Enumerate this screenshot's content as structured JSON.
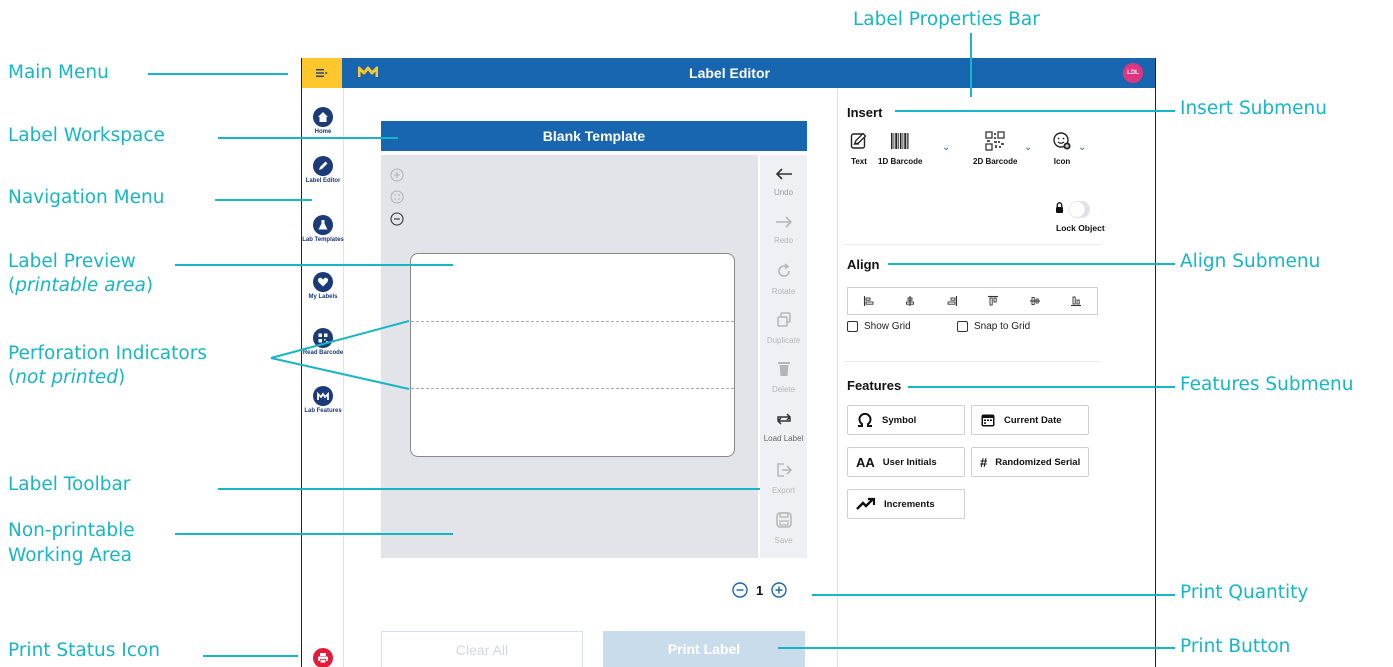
{
  "callouts": {
    "label_properties_bar": "Label Properties Bar",
    "main_menu": "Main Menu",
    "label_workspace": "Label Workspace",
    "navigation_menu": "Navigation Menu",
    "label_preview": "Label Preview",
    "label_preview_sub": "printable area",
    "perforation_indicators": "Perforation Indicators",
    "perforation_sub": "not printed",
    "label_toolbar": "Label Toolbar",
    "non_printable_1": "Non-printable",
    "non_printable_2": "Working Area",
    "print_status_icon": "Print Status Icon",
    "insert_submenu": "Insert Submenu",
    "align_submenu": "Align Submenu",
    "features_submenu": "Features Submenu",
    "print_quantity": "Print Quantity",
    "print_button": "Print Button"
  },
  "app": {
    "title": "Label Editor",
    "avatar_initials": "LDL",
    "brand_color": "#1866b0",
    "menu_color": "#ffc72c"
  },
  "nav": {
    "items": [
      {
        "label": "Home",
        "icon": "home-icon"
      },
      {
        "label": "Label Editor",
        "icon": "pencil-icon"
      },
      {
        "label": "Lab Templates",
        "icon": "flask-icon"
      },
      {
        "label": "My Labels",
        "icon": "heart-icon"
      },
      {
        "label": "Read Barcode",
        "icon": "qr-code-icon"
      },
      {
        "label": "Lab Features",
        "icon": "brand-logo-icon"
      }
    ]
  },
  "workspace": {
    "template_title": "Blank Template",
    "print_quantity": "1",
    "clear_all": "Clear All",
    "print_label": "Print Label"
  },
  "toolbar": {
    "undo": "Undo",
    "redo": "Redo",
    "rotate": "Rotate",
    "duplicate": "Duplicate",
    "delete": "Delete",
    "load_label": "Load Label",
    "export": "Export",
    "save": "Save"
  },
  "insert": {
    "title": "Insert",
    "text": "Text",
    "barcode_1d": "1D Barcode",
    "barcode_2d": "2D Barcode",
    "icon": "Icon",
    "lock_object": "Lock Object"
  },
  "align": {
    "title": "Align",
    "show_grid": "Show Grid",
    "snap_to_grid": "Snap to Grid"
  },
  "features": {
    "title": "Features",
    "symbol": "Symbol",
    "current_date": "Current Date",
    "user_initials": "User Initials",
    "randomized_serial": "Randomized Serial",
    "increments": "Increments"
  }
}
